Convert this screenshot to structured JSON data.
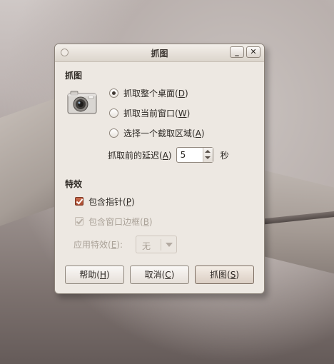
{
  "window": {
    "title": "抓图",
    "minimize_glyph": "_",
    "close_glyph": "✕"
  },
  "grab_section": {
    "label": "抓图",
    "icon": "camera-icon",
    "options": [
      {
        "text": "抓取整个桌面(",
        "key": "D",
        "suffix": ")",
        "selected": true
      },
      {
        "text": "抓取当前窗口(",
        "key": "W",
        "suffix": ")",
        "selected": false
      },
      {
        "text": "选择一个截取区域(",
        "key": "A",
        "suffix": ")",
        "selected": false
      }
    ],
    "delay": {
      "label": "抓取前的延迟(",
      "key": "A",
      "suffix": ")",
      "value": "5",
      "unit": "秒"
    }
  },
  "effects_section": {
    "label": "特效",
    "include_pointer": {
      "text": "包含指针(",
      "key": "P",
      "suffix": ")",
      "checked": true
    },
    "include_border": {
      "text": "包含窗口边框(",
      "key": "B",
      "suffix": ")",
      "checked": true,
      "disabled": true
    },
    "apply_effect": {
      "label": "应用特效(",
      "key": "E",
      "suffix": "):",
      "value": "无"
    }
  },
  "buttons": {
    "help": {
      "text": "帮助(",
      "key": "H",
      "suffix": ")"
    },
    "cancel": {
      "text": "取消(",
      "key": "C",
      "suffix": ")"
    },
    "grab": {
      "text": "抓图(",
      "key": "S",
      "suffix": ")"
    }
  },
  "colors": {
    "window_bg": "#ede8e2",
    "pointer_check": "#b0543a"
  }
}
